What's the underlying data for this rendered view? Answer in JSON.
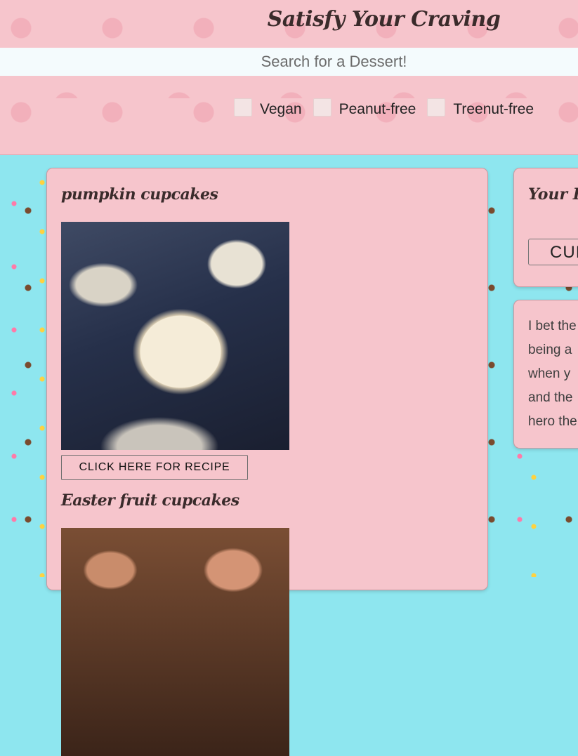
{
  "header": {
    "title": "Satisfy Your Craving",
    "search_placeholder": "Search for a Dessert!",
    "filters": [
      {
        "label": "Vegan",
        "checked": false
      },
      {
        "label": "Peanut-free",
        "checked": false
      },
      {
        "label": "Treenut-free",
        "checked": false
      }
    ]
  },
  "recipes": [
    {
      "title": "pumpkin cupcakes",
      "button": "CLICK HERE FOR RECIPE"
    },
    {
      "title": "Easter fruit cupcakes"
    }
  ],
  "sidebar": {
    "panel_title": "Your D",
    "select_value": "CUI",
    "text_lines": [
      "I bet the",
      "being a",
      "when y",
      "and the",
      "hero the"
    ]
  },
  "colors": {
    "panel_pink": "#f6c5cc",
    "background_cyan": "#8ee6ef",
    "search_bg": "#f4fbfd"
  }
}
